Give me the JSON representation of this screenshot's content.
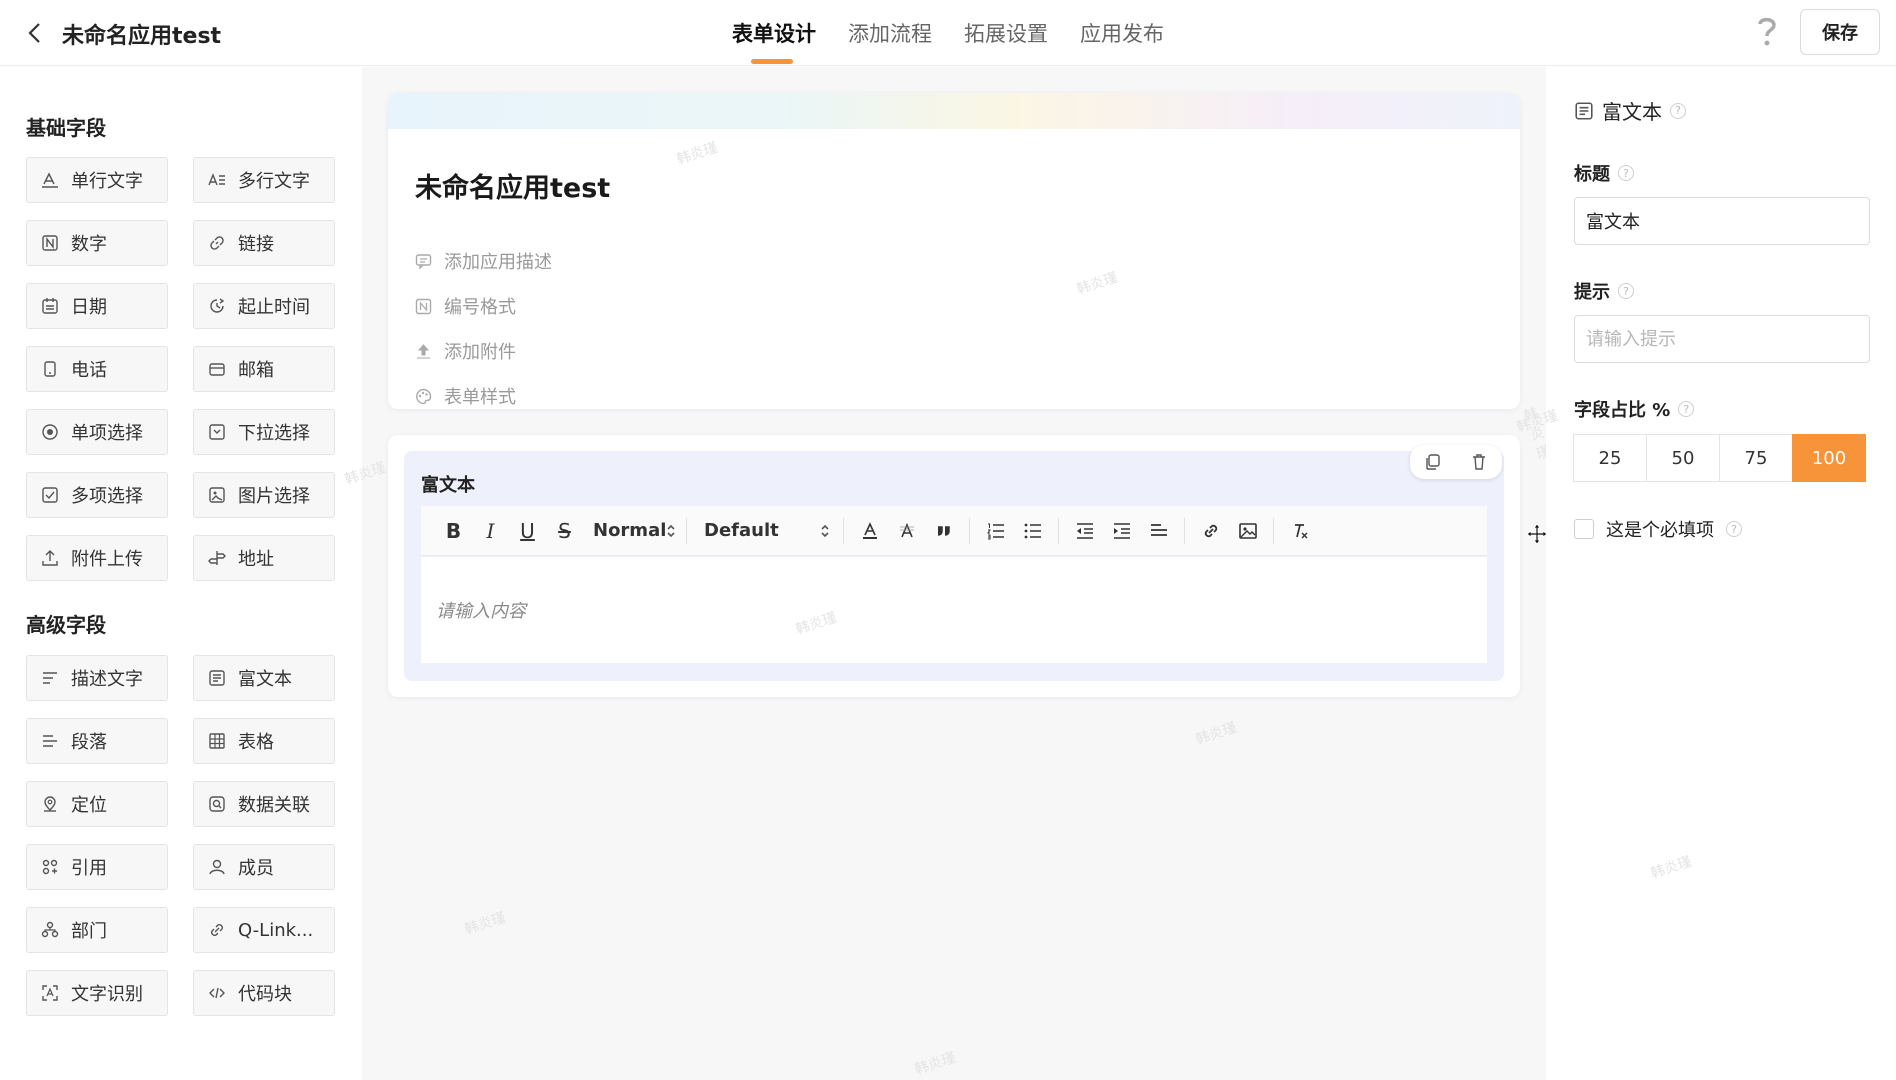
{
  "header": {
    "app_title": "未命名应用test",
    "tabs": [
      {
        "label": "表单设计",
        "active": true
      },
      {
        "label": "添加流程",
        "active": false
      },
      {
        "label": "拓展设置",
        "active": false
      },
      {
        "label": "应用发布",
        "active": false
      }
    ],
    "save_label": "保存"
  },
  "sidebar": {
    "basic_title": "基础字段",
    "basic_fields": [
      "单行文字",
      "多行文字",
      "数字",
      "链接",
      "日期",
      "起止时间",
      "电话",
      "邮箱",
      "单项选择",
      "下拉选择",
      "多项选择",
      "图片选择",
      "附件上传",
      "地址"
    ],
    "advanced_title": "高级字段",
    "advanced_fields": [
      "描述文字",
      "富文本",
      "段落",
      "表格",
      "定位",
      "数据关联",
      "引用",
      "成员",
      "部门",
      "Q-Link...",
      "文字识别",
      "代码块"
    ]
  },
  "form": {
    "title": "未命名应用test",
    "options": [
      "添加应用描述",
      "编号格式",
      "添加附件",
      "表单样式"
    ]
  },
  "richtext": {
    "label": "富文本",
    "font_size_select": "Normal",
    "font_family_select": "Default",
    "placeholder": "请输入内容"
  },
  "props": {
    "type_label": "富文本",
    "title_label": "标题",
    "title_value": "富文本",
    "hint_label": "提示",
    "hint_placeholder": "请输入提示",
    "ratio_label": "字段占比 %",
    "ratio_options": [
      "25",
      "50",
      "75",
      "100"
    ],
    "ratio_selected": "100",
    "required_label": "这是个必填项",
    "required_checked": false
  },
  "watermark": "韩炎瑾",
  "colors": {
    "accent": "#f7943a",
    "canvas_bg": "#f7f7f8",
    "selected_field_bg": "#eef1fb"
  }
}
